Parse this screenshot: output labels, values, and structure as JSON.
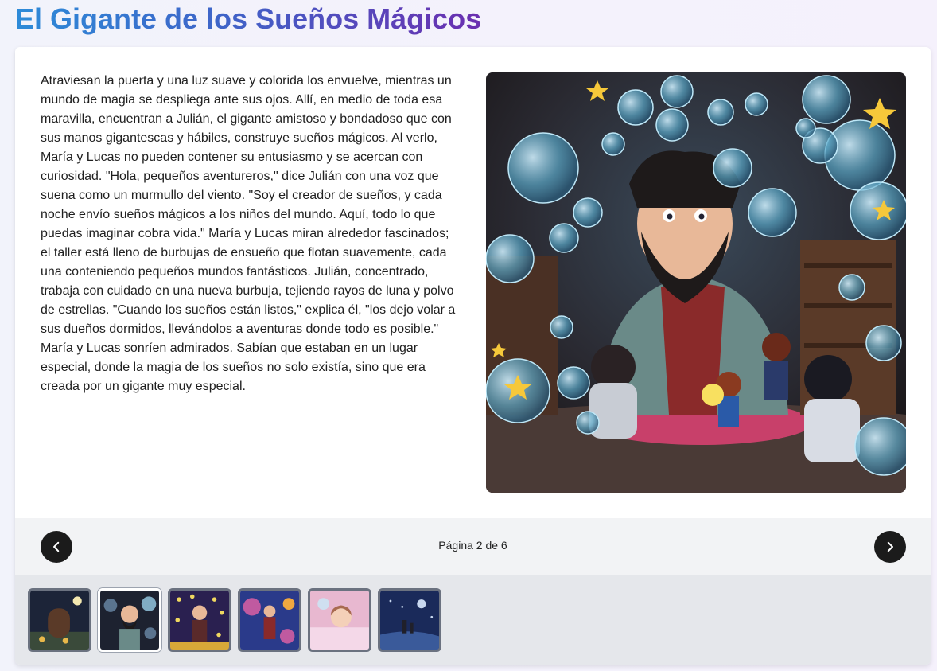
{
  "book": {
    "title": "El Gigante de los Sueños Mágicos"
  },
  "page": {
    "text": "Atraviesan la puerta y una luz suave y colorida los envuelve, mientras un mundo de magia se despliega ante sus ojos. Allí, en medio de toda esa maravilla, encuentran a Julián, el gigante amistoso y bondadoso que con sus manos gigantescas y hábiles, construye sueños mágicos. Al verlo, María y Lucas no pueden contener su entusiasmo y se acercan con curiosidad. \"Hola, pequeños aventureros,\" dice Julián con una voz que suena como un murmullo del viento. \"Soy el creador de sueños, y cada noche envío sueños mágicos a los niños del mundo. Aquí, todo lo que puedas imaginar cobra vida.\" María y Lucas miran alrededor fascinados; el taller está lleno de burbujas de ensueño que flotan suavemente, cada una conteniendo pequeños mundos fantásticos. Julián, concentrado, trabaja con cuidado en una nueva burbuja, tejiendo rayos de luna y polvo de estrellas. \"Cuando los sueños están listos,\" explica él, \"los dejo volar a sus dueños dormidos, llevándolos a aventuras donde todo es posible.\" María y Lucas sonríen admirados. Sabían que estaban en un lugar especial, donde la magia de los sueños no solo existía, sino que era creada por un gigante muy especial."
  },
  "navigation": {
    "indicator": "Página 2 de 6",
    "prev_icon": "chevron-left-icon",
    "next_icon": "chevron-right-icon"
  },
  "thumbnails": [
    {
      "name": "thumbnail-page-1",
      "active": false,
      "palette": [
        "#1c2438",
        "#3a4a3a",
        "#e8b84a"
      ]
    },
    {
      "name": "thumbnail-page-2",
      "active": true,
      "palette": [
        "#1d2230",
        "#6a8aa8",
        "#9ad0e8"
      ]
    },
    {
      "name": "thumbnail-page-3",
      "active": false,
      "palette": [
        "#2a2050",
        "#d8a838",
        "#f0d860"
      ]
    },
    {
      "name": "thumbnail-page-4",
      "active": false,
      "palette": [
        "#2a3a8a",
        "#c05aa0",
        "#f0a840"
      ]
    },
    {
      "name": "thumbnail-page-5",
      "active": false,
      "palette": [
        "#e8b8d0",
        "#f4d8e8",
        "#a86a50"
      ]
    },
    {
      "name": "thumbnail-page-6",
      "active": false,
      "palette": [
        "#1a2a5a",
        "#3a5a9a",
        "#c8d8f0"
      ]
    }
  ],
  "colors": {
    "title_gradient_start": "#2d8bd8",
    "title_gradient_end": "#6b2fb0",
    "nav_button": "#1b1b1b"
  }
}
